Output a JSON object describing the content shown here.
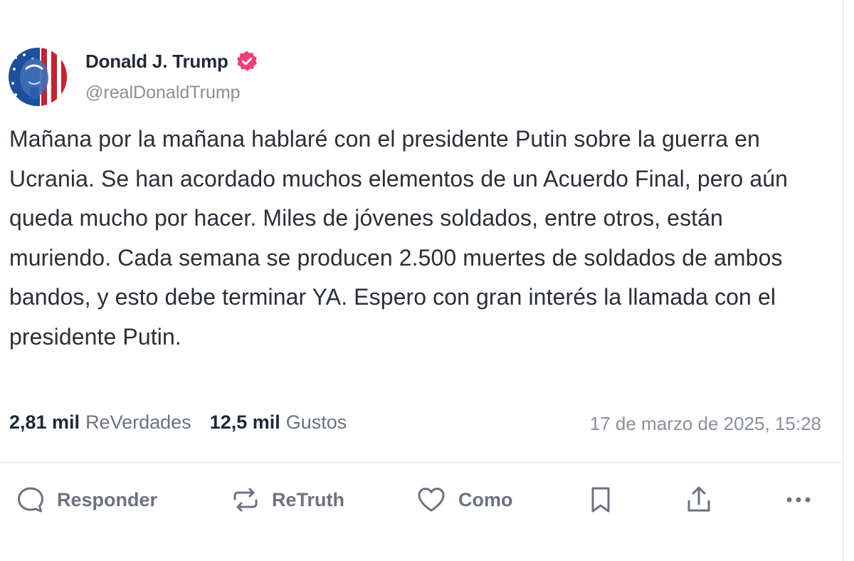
{
  "author": {
    "name": "Donald J. Trump",
    "handle": "@realDonaldTrump",
    "verified": true,
    "verified_color": "#f03e7a"
  },
  "post": {
    "text": "Mañana por la mañana hablaré con el presidente Putin sobre la guerra en Ucrania. Se han acordado muchos elementos de un Acuerdo Final, pero aún queda mucho por hacer. Miles de jóvenes soldados, entre otros, están muriendo. Cada semana se producen 2.500 muertes de soldados de ambos bandos, y esto debe terminar YA. Espero con gran interés la llamada con el presidente Putin.",
    "timestamp": "17 de marzo de 2025, 15:28"
  },
  "stats": {
    "retruths_count": "2,81 mil",
    "retruths_label": "ReVerdades",
    "likes_count": "12,5 mil",
    "likes_label": "Gustos"
  },
  "actions": {
    "reply_label": "Responder",
    "retruth_label": "ReTruth",
    "like_label": "Como",
    "icons": [
      "reply-icon",
      "retruth-icon",
      "heart-icon",
      "bookmark-icon",
      "share-icon",
      "more-icon"
    ]
  }
}
